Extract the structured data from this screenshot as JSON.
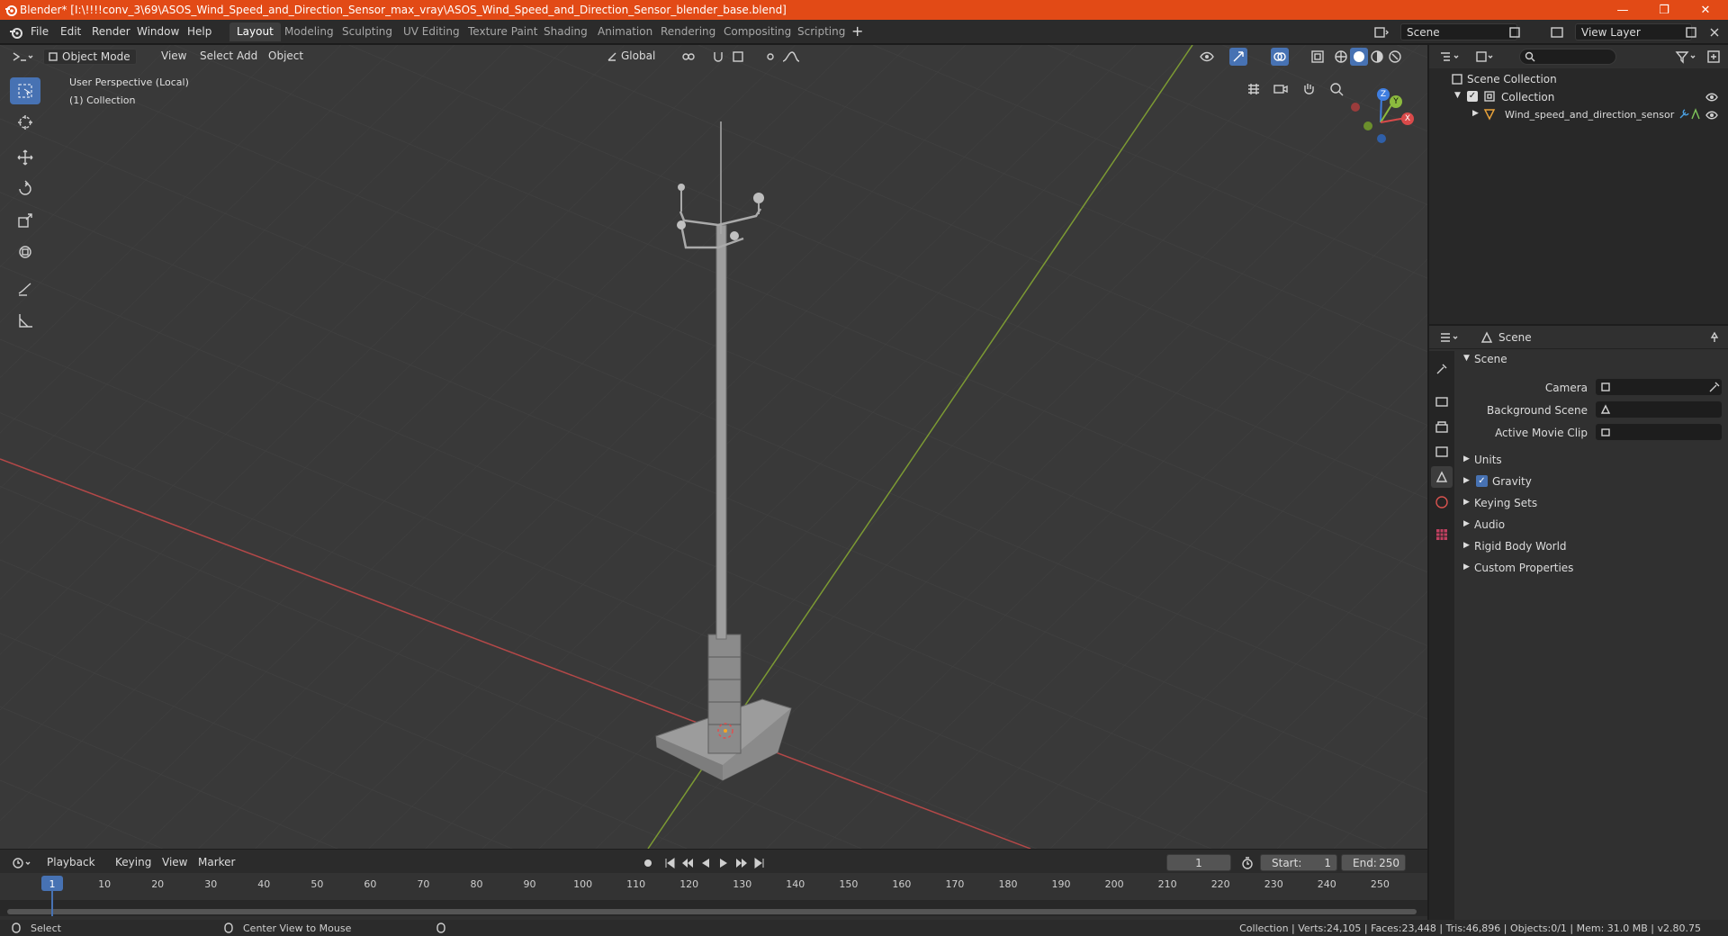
{
  "window": {
    "title": "Blender* [I:\\!!!!conv_3\\69\\ASOS_Wind_Speed_and_Direction_Sensor_max_vray\\ASOS_Wind_Speed_and_Direction_Sensor_blender_base.blend]",
    "minimize": "—",
    "maximize": "❐",
    "close": "✕"
  },
  "menu": [
    "File",
    "Edit",
    "Render",
    "Window",
    "Help"
  ],
  "workspaces": [
    "Layout",
    "Modeling",
    "Sculpting",
    "UV Editing",
    "Texture Paint",
    "Shading",
    "Animation",
    "Rendering",
    "Compositing",
    "Scripting"
  ],
  "active_workspace": "Layout",
  "scene_field": "Scene",
  "view_layer_field": "View Layer",
  "viewport": {
    "mode": "Object Mode",
    "menus": [
      "View",
      "Select",
      "Add",
      "Object"
    ],
    "transform": "Global",
    "overlay_line1": "User Perspective (Local)",
    "overlay_line2": "(1) Collection",
    "gizmo_x": "X",
    "gizmo_y": "Y",
    "gizmo_z": "Z"
  },
  "outliner": {
    "root": "Scene Collection",
    "collection": "Collection",
    "object": "Wind_speed_and_direction_sensor"
  },
  "properties": {
    "header": "Scene",
    "panel_title": "Scene",
    "camera_label": "Camera",
    "background_scene_label": "Background Scene",
    "active_movie_clip_label": "Active Movie Clip",
    "sections": [
      "Units",
      "Gravity",
      "Keying Sets",
      "Audio",
      "Rigid Body World",
      "Custom Properties"
    ]
  },
  "timeline": {
    "menus": [
      "Playback",
      "Keying",
      "View",
      "Marker"
    ],
    "current_frame": "1",
    "start_label": "Start:",
    "start": "1",
    "end_label": "End:",
    "end": "250",
    "ruler": [
      "1",
      "10",
      "20",
      "30",
      "40",
      "50",
      "60",
      "70",
      "80",
      "90",
      "100",
      "110",
      "120",
      "130",
      "140",
      "150",
      "160",
      "170",
      "180",
      "190",
      "200",
      "210",
      "220",
      "230",
      "240",
      "250"
    ]
  },
  "status": {
    "select": "Select",
    "center_view": "Center View to Mouse",
    "info": "Collection | Verts:24,105 | Faces:23,448 | Tris:46,896 | Objects:0/1 | Mem: 31.0 MB | v2.80.75"
  },
  "colors": {
    "titlebar": "#e24a16",
    "accent": "#4772b3",
    "x_axis": "#d94a4a",
    "y_axis": "#8cba3e",
    "z_axis": "#3f7ee0"
  }
}
